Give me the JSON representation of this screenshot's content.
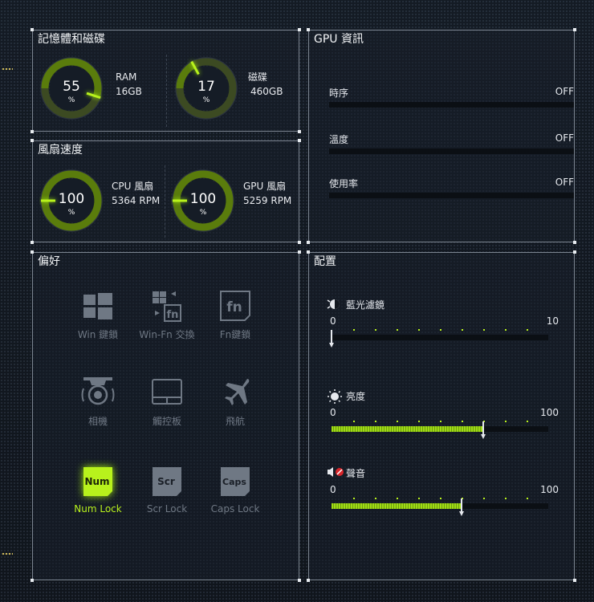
{
  "memory": {
    "title": "記憶體和磁碟",
    "ram": {
      "value": "55",
      "unit": "%",
      "name": "RAM",
      "size": "16GB",
      "level": 0.55
    },
    "disk": {
      "value": "17",
      "unit": "%",
      "name": "磁碟",
      "size": "460GB",
      "level": 0.17
    }
  },
  "fans": {
    "title": "風扇速度",
    "cpu": {
      "value": "100",
      "unit": "%",
      "name": "CPU 風扇",
      "rpm": "5364 RPM",
      "level": 1.0
    },
    "gpu": {
      "value": "100",
      "unit": "%",
      "name": "GPU 風扇",
      "rpm": "5259 RPM",
      "level": 1.0
    }
  },
  "gpu_info": {
    "title": "GPU 資訊",
    "rows": [
      {
        "label": "時序",
        "value": "OFF"
      },
      {
        "label": "溫度",
        "value": "OFF"
      },
      {
        "label": "使用率",
        "value": "OFF"
      }
    ]
  },
  "preferences": {
    "title": "偏好",
    "items": [
      {
        "label": "Win 鍵鎖",
        "icon": "windows-icon",
        "active": false
      },
      {
        "label": "Win-Fn 交換",
        "icon": "win-fn-swap-icon",
        "active": false
      },
      {
        "label": "Fn鍵鎖",
        "icon": "fn-key-icon",
        "active": false
      },
      {
        "label": "相機",
        "icon": "camera-icon",
        "active": false
      },
      {
        "label": "觸控板",
        "icon": "touchpad-icon",
        "active": false
      },
      {
        "label": "飛航",
        "icon": "airplane-icon",
        "active": false
      },
      {
        "label": "Num Lock",
        "key": "Num",
        "icon": "num-lock-icon",
        "active": true
      },
      {
        "label": "Scr Lock",
        "key": "Scr",
        "icon": "scroll-lock-icon",
        "active": false
      },
      {
        "label": "Caps Lock",
        "key": "Caps",
        "icon": "caps-lock-icon",
        "active": false
      }
    ]
  },
  "config": {
    "title": "配置",
    "sliders": [
      {
        "name": "藍光濾鏡",
        "icon": "blue-light-filter-icon",
        "min": "0",
        "max": "10",
        "value": 0,
        "range": 10
      },
      {
        "name": "亮度",
        "icon": "brightness-icon",
        "min": "0",
        "max": "100",
        "value": 70,
        "range": 100
      },
      {
        "name": "聲音",
        "icon": "volume-icon",
        "min": "0",
        "max": "100",
        "value": 60,
        "range": 100
      }
    ]
  },
  "colors": {
    "accent": "#b8f21c",
    "gauge_fill": "#5a7c0c",
    "panel_border": "#7b8490",
    "text": "#e6e9ee"
  }
}
